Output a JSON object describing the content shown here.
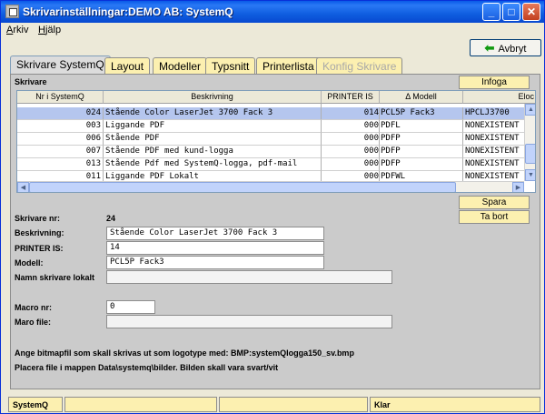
{
  "window": {
    "title": "Skrivarinställningar:DEMO AB: SystemQ",
    "controls": {
      "minimize": "_",
      "maximize": "□",
      "close": "✕"
    }
  },
  "menu": {
    "items": [
      "Arkiv",
      "Hjälp"
    ]
  },
  "toolbar": {
    "cancel_label": "Avbryt",
    "cancel_icon": "green-left-arrow"
  },
  "tabs": [
    {
      "label": "Skrivare SystemQ",
      "state": "active"
    },
    {
      "label": "Layout",
      "state": "normal"
    },
    {
      "label": "Modeller",
      "state": "normal"
    },
    {
      "label": "Typsnitt",
      "state": "normal"
    },
    {
      "label": "Printerlista",
      "state": "normal"
    },
    {
      "label": "Konfig Skrivare",
      "state": "disabled"
    }
  ],
  "panel": {
    "section_title": "Skrivare",
    "insert_label": "Infoga",
    "save_label": "Spara",
    "delete_label": "Ta bort"
  },
  "table": {
    "columns": [
      "Nr i SystemQ",
      "Beskrivning",
      "PRINTER IS",
      "Δ Modell",
      "Eloc"
    ],
    "rows": [
      {
        "nr": "024",
        "beskrivning": "Stående Color LaserJet 3700 Fack 3",
        "printer_is": "014",
        "modell": "PCL5P Fack3",
        "eloc": "HPCLJ3700",
        "selected": true
      },
      {
        "nr": "003",
        "beskrivning": "Liggande PDF",
        "printer_is": "000",
        "modell": "PDFL",
        "eloc": "NONEXISTENT",
        "selected": false
      },
      {
        "nr": "006",
        "beskrivning": "Stående PDF",
        "printer_is": "000",
        "modell": "PDFP",
        "eloc": "NONEXISTENT",
        "selected": false
      },
      {
        "nr": "007",
        "beskrivning": "Stående PDF med  kund-logga",
        "printer_is": "000",
        "modell": "PDFP",
        "eloc": "NONEXISTENT",
        "selected": false
      },
      {
        "nr": "013",
        "beskrivning": "Stående Pdf med SystemQ-logga, pdf-mail",
        "printer_is": "000",
        "modell": "PDFP",
        "eloc": "NONEXISTENT",
        "selected": false
      },
      {
        "nr": "011",
        "beskrivning": "Liggande PDF Lokalt",
        "printer_is": "000",
        "modell": "PDFWL",
        "eloc": "NONEXISTENT",
        "selected": false
      }
    ]
  },
  "form": {
    "skrivare_nr_label": "Skrivare nr:",
    "skrivare_nr_value": "24",
    "beskrivning_label": "Beskrivning:",
    "beskrivning_value": "Stående Color LaserJet 3700 Fack 3",
    "printer_is_label": "PRINTER IS:",
    "printer_is_value": "14",
    "modell_label": "Modell:",
    "modell_value": "PCL5P Fack3",
    "namn_lokalt_label": "Namn skrivare lokalt",
    "namn_lokalt_value": "",
    "macro_nr_label": "Macro nr:",
    "macro_nr_value": "0",
    "maro_file_label": "Maro file:",
    "maro_file_value": ""
  },
  "notes": {
    "line1": "Ange bitmapfil som skall skrivas ut som logotype med: BMP:systemQlogga150_sv.bmp",
    "line2": "Placera file i mappen Data\\systemq\\bilder. Bilden skall vara svart/vit"
  },
  "statusbar": {
    "left": "SystemQ",
    "right": "Klar"
  },
  "colors": {
    "tab_bg": "#fcf0b0",
    "panel_bg": "#cbcbcb",
    "selected_row": "#b5c6ee",
    "titlebar": "#0a5ae8"
  }
}
